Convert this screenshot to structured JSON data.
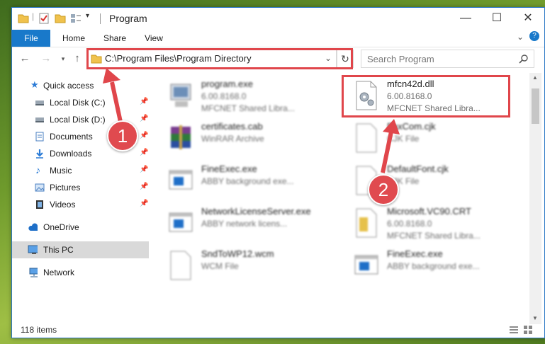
{
  "window": {
    "title": "Program",
    "min": "—",
    "max": "☐",
    "close": "✕"
  },
  "ribbon": {
    "tabs": [
      "File",
      "Home",
      "Share",
      "View"
    ],
    "expand": "⌄",
    "help": "?"
  },
  "address": {
    "path": "C:\\Program Files\\Program Directory"
  },
  "search": {
    "placeholder": "Search Program"
  },
  "nav": {
    "quick_access": "Quick access",
    "items": [
      "Local Disk (C:)",
      "Local Disk (D:)",
      "Documents",
      "Downloads",
      "Music",
      "Pictures",
      "Videos"
    ],
    "onedrive": "OneDrive",
    "thispc": "This PC",
    "network": "Network"
  },
  "files": [
    {
      "name": "program.exe",
      "line1": "6.00.8168.0",
      "line2": "MFCNET Shared Libra..."
    },
    {
      "name": "mfcn42d.dll",
      "line1": "6.00.8168.0",
      "line2": "MFCNET Shared Libra..."
    },
    {
      "name": "certificates.cab",
      "line1": "WinRAR Archive",
      "line2": ""
    },
    {
      "name": "FaxCom.cjk",
      "line1": "CJK File",
      "line2": ""
    },
    {
      "name": "FineExec.exe",
      "line1": "ABBY background exe...",
      "line2": ""
    },
    {
      "name": "DefaultFont.cjk",
      "line1": "CJK File",
      "line2": ""
    },
    {
      "name": "NetworkLicenseServer.exe",
      "line1": "ABBY network licens...",
      "line2": ""
    },
    {
      "name": "Microsoft.VC90.CRT",
      "line1": "6.00.8168.0",
      "line2": "MFCNET Shared Libra..."
    },
    {
      "name": "SndToWP12.wcm",
      "line1": "WCM File",
      "line2": ""
    },
    {
      "name": "FineExec.exe",
      "line1": "ABBY background exe...",
      "line2": ""
    }
  ],
  "status": {
    "count": "118 items"
  },
  "annotations": {
    "step1": "1",
    "step2": "2"
  },
  "colors": {
    "accent": "#1979ca",
    "annotation": "#e0464b"
  }
}
